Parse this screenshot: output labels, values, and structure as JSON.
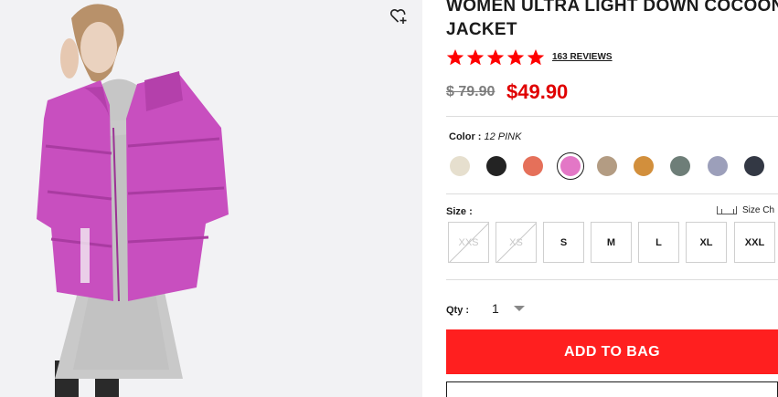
{
  "product": {
    "title": "WOMEN ULTRA LIGHT DOWN COCOON\nJACKET",
    "rating": 5,
    "reviews_text": "163 REVIEWS",
    "old_price": "$ 79.90",
    "new_price": "$49.90"
  },
  "color": {
    "label": "Color :",
    "selected_value": "12 PINK",
    "swatches": [
      {
        "name": "off-white",
        "hex": "#e6dfce"
      },
      {
        "name": "black",
        "hex": "#232323"
      },
      {
        "name": "coral",
        "hex": "#e5705a"
      },
      {
        "name": "pink",
        "hex": "#e377c6",
        "selected": true
      },
      {
        "name": "beige",
        "hex": "#b39c83"
      },
      {
        "name": "mustard",
        "hex": "#d28f3c"
      },
      {
        "name": "gray-green",
        "hex": "#6e7e78"
      },
      {
        "name": "lavender-gray",
        "hex": "#9c9fba"
      },
      {
        "name": "navy",
        "hex": "#333844"
      }
    ]
  },
  "size": {
    "label": "Size :",
    "chart_label": "Size Ch",
    "options": [
      {
        "label": "XXS",
        "available": false
      },
      {
        "label": "XS",
        "available": false
      },
      {
        "label": "S",
        "available": true
      },
      {
        "label": "M",
        "available": true
      },
      {
        "label": "L",
        "available": true
      },
      {
        "label": "XL",
        "available": true
      },
      {
        "label": "XXL",
        "available": true
      }
    ]
  },
  "quantity": {
    "label": "Qty :",
    "value": "1"
  },
  "actions": {
    "add_to_bag": "ADD TO BAG"
  },
  "icons": {
    "wishlist": "heart-plus-icon",
    "star": "star-icon",
    "size_chart": "ruler-icon",
    "qty_caret": "chevron-down-icon"
  },
  "colors": {
    "accent": "#ff1f1f",
    "price": "#e00000",
    "star": "#ff0000"
  }
}
